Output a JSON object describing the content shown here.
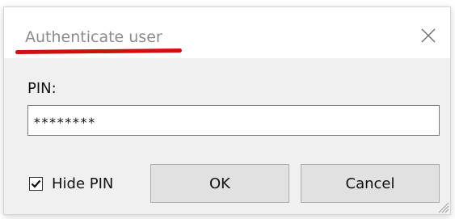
{
  "dialog": {
    "title": "Authenticate user",
    "close_icon": "close-icon",
    "pin_label": "PIN:",
    "pin_value": "********",
    "hide_pin": {
      "label": "Hide PIN",
      "checked": true
    },
    "buttons": {
      "ok_label": "OK",
      "cancel_label": "Cancel"
    },
    "resize_grip_icon": "resize-grip-icon"
  },
  "colors": {
    "annotation_underline": "#d01010",
    "title_text": "#8c8c8c",
    "dialog_background": "#f0f0f0",
    "button_background": "#e1e1e1"
  }
}
